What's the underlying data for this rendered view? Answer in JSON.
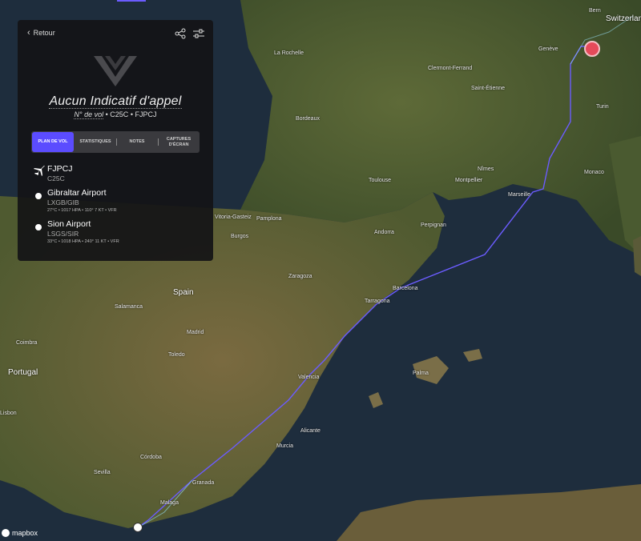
{
  "header": {
    "back_label": "Retour"
  },
  "flight": {
    "callsign": "Aucun Indicatif d'appel",
    "flight_no_label": "N° de vol",
    "flight_no": "C25C",
    "registration": "FJPCJ",
    "separator": "•"
  },
  "tabs": [
    {
      "label": "PLAN DE VOL",
      "active": true
    },
    {
      "label": "STATISTIQUES",
      "active": false
    },
    {
      "label": "NOTES",
      "active": false
    },
    {
      "label": "CAPTURES D'ÉCRAN",
      "active": false
    }
  ],
  "aircraft": {
    "name": "FJPCJ",
    "code": "C25C"
  },
  "departure": {
    "name": "Gibraltar Airport",
    "code": "LXGB/GIB",
    "weather": "27°C • 1017 HPA • 110° 7 KT • VFR"
  },
  "arrival": {
    "name": "Sion Airport",
    "code": "LSGS/SIR",
    "weather": "33°C • 1018 HPA • 240° 11 KT • VFR"
  },
  "map": {
    "attribution": "mapbox",
    "route_color": "#6b5cff",
    "labels": {
      "switzerland": "Switzerland",
      "bern": "Bern",
      "geneve": "Genève",
      "turin": "Turin",
      "monaco": "Monaco",
      "marseille": "Marseille",
      "la_rochelle": "La Rochelle",
      "clermont": "Clermont-Ferrand",
      "saint_etienne": "Saint-Étienne",
      "bordeaux": "Bordeaux",
      "toulouse": "Toulouse",
      "montpellier": "Montpellier",
      "nimes": "Nîmes",
      "perpignan": "Perpignan",
      "andorra": "Andorra",
      "pamplona": "Pamplona",
      "vitoria": "Vitoria-Gasteiz",
      "burgos": "Burgos",
      "zaragoza": "Zaragoza",
      "barcelona": "Barcelona",
      "tarragona": "Tarragona",
      "spain": "Spain",
      "madrid": "Madrid",
      "salamanca": "Salamanca",
      "coimbra": "Coimbra",
      "portugal": "Portugal",
      "lisbon": "Lisbon",
      "valencia": "Valencia",
      "palma": "Palma",
      "alicante": "Alicante",
      "murcia": "Murcia",
      "granada": "Granada",
      "malaga": "Malaga",
      "cordoba": "Córdoba",
      "sevilla": "Sevilla",
      "toledo": "Toledo"
    }
  }
}
